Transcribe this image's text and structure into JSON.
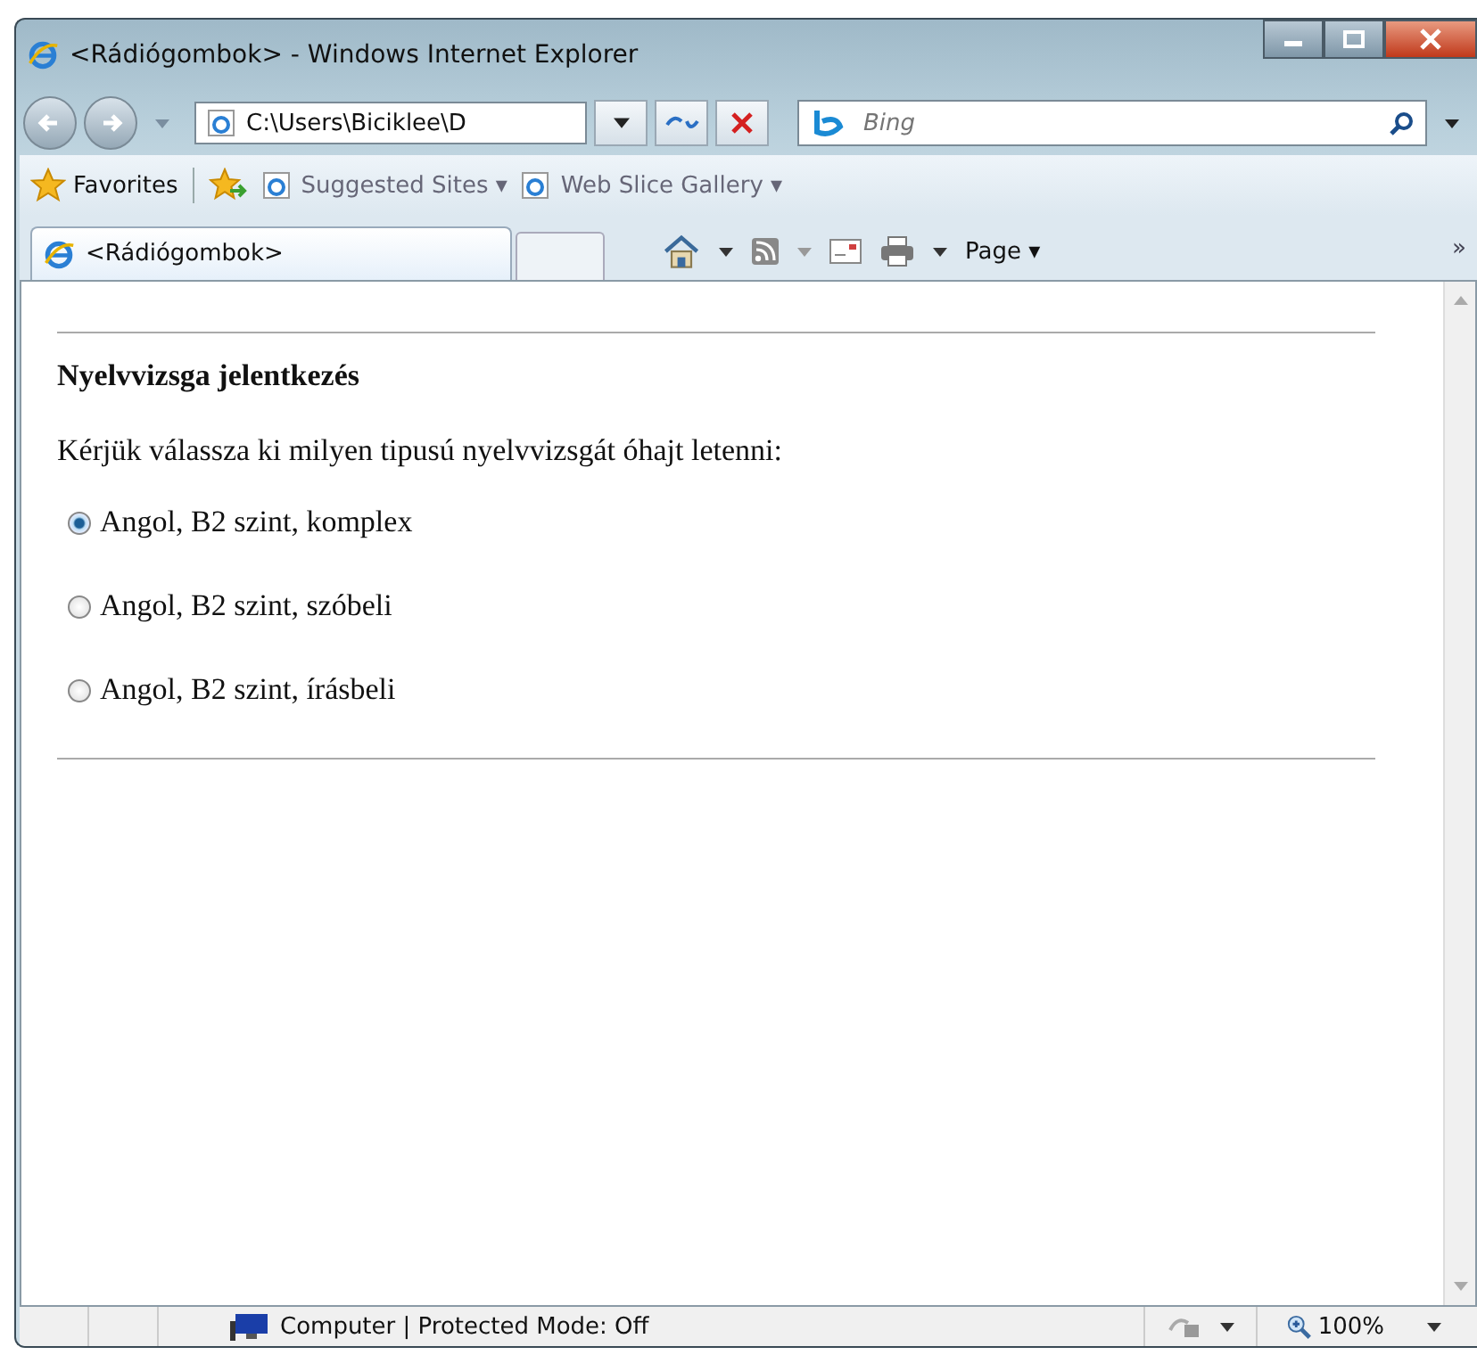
{
  "window": {
    "title": "<Rádiógombok> - Windows Internet Explorer"
  },
  "address_bar": {
    "value": "C:\\Users\\Biciklee\\D"
  },
  "search": {
    "placeholder": "Bing"
  },
  "favorites_bar": {
    "favorites": "Favorites",
    "links": [
      "Suggested Sites ▾",
      "Web Slice Gallery ▾"
    ]
  },
  "tabs": [
    {
      "label": "<Rádiógombok>",
      "selected": true
    }
  ],
  "command_bar": {
    "page": "Page ▾",
    "overflow": "»"
  },
  "page": {
    "heading": "Nyelvvizsga jelentkezés",
    "prompt": "Kérjük válassza ki milyen tipusú nyelvvizsgát óhajt letenni:",
    "options": [
      {
        "label": "Angol, B2 szint, komplex",
        "selected": true
      },
      {
        "label": "Angol, B2 szint, szóbeli",
        "selected": false
      },
      {
        "label": "Angol, B2 szint, írásbeli",
        "selected": false
      }
    ]
  },
  "status_bar": {
    "zone": "Computer | Protected Mode: Off",
    "zoom": "100%"
  }
}
